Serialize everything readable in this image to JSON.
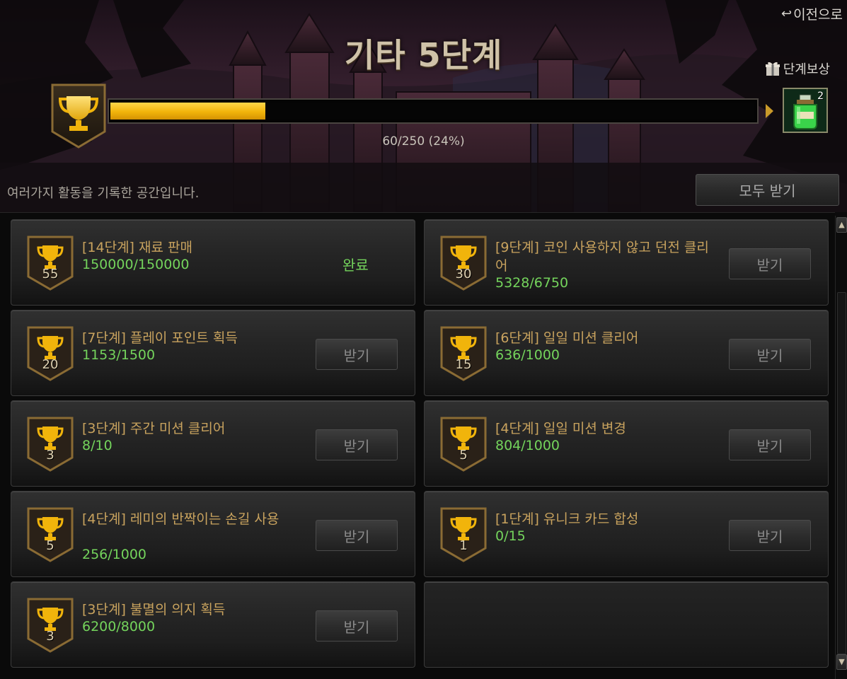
{
  "header": {
    "back_label": "이전으로",
    "title": "기타 5단계",
    "stage_reward_label": "단계보상",
    "reward_count": "2",
    "progress": {
      "current": 60,
      "max": 250,
      "percent": 24,
      "text": "60/250 (24%)"
    },
    "description": "여러가지 활동을 기록한 공간입니다.",
    "claim_all_label": "모두 받기"
  },
  "achievements": [
    {
      "points": "55",
      "title": "[14단계] 재료 판매",
      "progress": "150000/150000",
      "status": "완료",
      "completed": true
    },
    {
      "points": "30",
      "title": "[9단계] 코인 사용하지 않고 던전 클리어",
      "progress": "5328/6750",
      "action": "받기",
      "completed": false
    },
    {
      "points": "20",
      "title": "[7단계] 플레이 포인트 획득",
      "progress": "1153/1500",
      "action": "받기",
      "completed": false
    },
    {
      "points": "15",
      "title": "[6단계] 일일 미션 클리어",
      "progress": "636/1000",
      "action": "받기",
      "completed": false
    },
    {
      "points": "3",
      "title": "[3단계] 주간 미션 클리어",
      "progress": "8/10",
      "action": "받기",
      "completed": false
    },
    {
      "points": "5",
      "title": "[4단계] 일일 미션 변경",
      "progress": "804/1000",
      "action": "받기",
      "completed": false
    },
    {
      "points": "5",
      "title": "[4단계] 레미의 반짝이는 손길 사용",
      "progress": "256/1000",
      "action": "받기",
      "completed": false
    },
    {
      "points": "1",
      "title": "[1단계] 유니크 카드 합성",
      "progress": "0/15",
      "action": "받기",
      "completed": false
    },
    {
      "points": "3",
      "title": "[3단계] 불멸의 의지 획득",
      "progress": "6200/8000",
      "action": "받기",
      "completed": false
    }
  ],
  "colors": {
    "accent_gold": "#f1b40b",
    "progress_green": "#74d45c",
    "title_gold": "#c9a35e"
  },
  "icons": {
    "back": "return-arrow-icon",
    "stage_reward": "gift-icon",
    "trophy": "trophy-icon",
    "reward_item": "potion-bottle-icon"
  }
}
